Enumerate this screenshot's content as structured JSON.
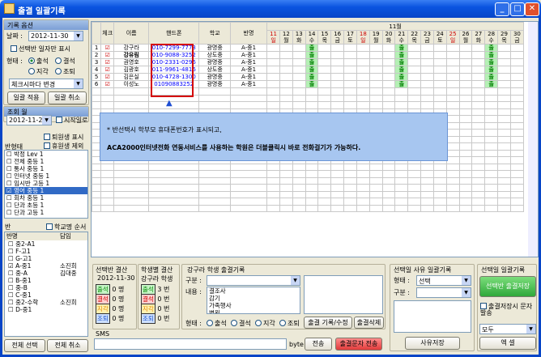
{
  "window": {
    "title": "출결 일괄기록"
  },
  "left": {
    "record_group_title": "기록 옵션",
    "date_label": "날짜 :",
    "date_value": "2012-11-30",
    "only_selected_label": "선택반 일자만 표시",
    "status_label": "형태 :",
    "statuses": [
      "출석",
      "결석",
      "지각",
      "조퇴"
    ],
    "check_change": "체크시마다 변경",
    "apply_btn": "일괄 적용",
    "cancel_btn": "일괄 취소",
    "view_month_title": "조회 월",
    "month_value": "2012-11-29",
    "start_date_label": "시작일로",
    "show_withdrawn": "퇴원생 표시",
    "exclude_rest": "휴원생 제외",
    "class_type_label": "반형태",
    "class_types": [
      "박정 Lev 1",
      "전체 중등 1",
      "통사 중등 1",
      "인터넷 중등 1",
      "임시반 고등 1",
      "영어 중등 1",
      "회차 중등 1",
      "단과 초등 1",
      "단과 고등 1"
    ],
    "class_label": "반",
    "class_sort": "학교명 순서",
    "class_col1": "반명",
    "class_col2": "담임",
    "classes": [
      {
        "name": "중2-A1",
        "teacher": ""
      },
      {
        "name": "F-고1",
        "teacher": ""
      },
      {
        "name": "G-고1",
        "teacher": ""
      },
      {
        "name": "A-중1",
        "teacher": "소진희"
      },
      {
        "name": "중-A",
        "teacher": "김대중"
      },
      {
        "name": "B-중1",
        "teacher": ""
      },
      {
        "name": "중-B",
        "teacher": ""
      },
      {
        "name": "C-중1",
        "teacher": ""
      },
      {
        "name": "중2-수학",
        "teacher": "소진희"
      },
      {
        "name": "D-중1",
        "teacher": ""
      }
    ],
    "select_all": "전체 선택",
    "cancel_all": "전체 취소"
  },
  "grid": {
    "month": "11월",
    "headers": {
      "check": "체크",
      "name": "이름",
      "phone": "핸드폰",
      "school": "학교",
      "class": "반명"
    },
    "days": [
      {
        "d": "11",
        "w": "일"
      },
      {
        "d": "12",
        "w": "월"
      },
      {
        "d": "13",
        "w": "화"
      },
      {
        "d": "14",
        "w": "수"
      },
      {
        "d": "15",
        "w": "목"
      },
      {
        "d": "16",
        "w": "금"
      },
      {
        "d": "17",
        "w": "토"
      },
      {
        "d": "18",
        "w": "일"
      },
      {
        "d": "19",
        "w": "월"
      },
      {
        "d": "20",
        "w": "화"
      },
      {
        "d": "21",
        "w": "수"
      },
      {
        "d": "22",
        "w": "목"
      },
      {
        "d": "23",
        "w": "금"
      },
      {
        "d": "24",
        "w": "토"
      },
      {
        "d": "25",
        "w": "일"
      },
      {
        "d": "26",
        "w": "월"
      },
      {
        "d": "27",
        "w": "화"
      },
      {
        "d": "28",
        "w": "수"
      },
      {
        "d": "29",
        "w": "목"
      },
      {
        "d": "30",
        "w": "금"
      }
    ],
    "mark": "출",
    "rows": [
      {
        "no": "1",
        "name": "강구라",
        "phone": "010-7299-7773",
        "school": "광명중",
        "class": "A-중1"
      },
      {
        "no": "2",
        "name": "강유림",
        "phone": "010-9088-3252",
        "school": "상도중",
        "class": "A-중1"
      },
      {
        "no": "3",
        "name": "권영호",
        "phone": "010-2331-0296",
        "school": "광명중",
        "class": "A-중1"
      },
      {
        "no": "4",
        "name": "김광호",
        "phone": "011-9961-4816",
        "school": "상도중",
        "class": "A-중1"
      },
      {
        "no": "5",
        "name": "김은실",
        "phone": "010-4728-1300",
        "school": "광명중",
        "class": "A-중1"
      },
      {
        "no": "6",
        "name": "이성노",
        "phone": "01090883252",
        "school": "광명중",
        "class": "A-중1"
      }
    ]
  },
  "tip": {
    "line1": "* 반선택시 학부모 휴대폰번호가 표시되고,",
    "line2": "ACA2000인터넷전화 연동서비스를 사용하는 학원은 더블클릭시 바로 전화걸기가 가능하다."
  },
  "bottom": {
    "sel_class_title": "선택반 결산",
    "sel_date": "2012-11-30",
    "student_title": "학생별 결산",
    "student_name": "강구라 학생",
    "stat_labels": [
      "출석",
      "결석",
      "지각",
      "조퇴"
    ],
    "sel_counts": [
      "0 명",
      "0 명",
      "0 명",
      "0 명"
    ],
    "stu_counts": [
      "3 번",
      "0 번",
      "0 번",
      "0 번"
    ],
    "record_title": "강구라 학생 출결기록",
    "kind_label": "구분 :",
    "content_label": "내용 :",
    "contents": [
      "결조사",
      "감기",
      "가족행사",
      "병원"
    ],
    "form_label": "형태 :",
    "forms": [
      "출석",
      "결석",
      "지각",
      "조퇴"
    ],
    "save_btn": "출결 기록/수정",
    "del_btn": "출결삭제",
    "reason_title": "선택일 사유 일괄기록",
    "reason_form_label": "형태 :",
    "reason_form_value": "선택",
    "reason_kind_label": "구분 :",
    "reason_save": "사유저장",
    "batch_title": "선택일 일괄기록",
    "batch_save": "선택반 출결저장",
    "save_msg": "출결저장시 문자발송",
    "all_combo": "모두",
    "excel": "엑 셀",
    "sms_label": "SMS",
    "byte": "byte",
    "send": "전송",
    "send_absent": "출결문자 전송"
  }
}
